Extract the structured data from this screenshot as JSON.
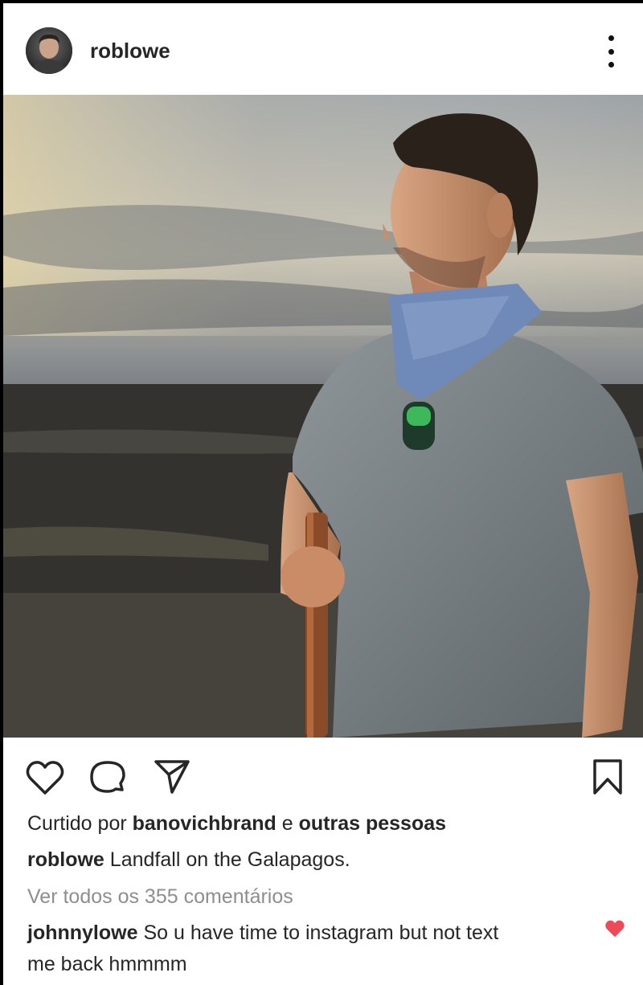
{
  "post": {
    "username": "roblowe",
    "image_alt": "Man in grey t-shirt and blue bandana holding a walking stick, looking out over a landscape at dusk"
  },
  "likes": {
    "prefix": "Curtido por",
    "user": "banovichbrand",
    "conjunction": "e",
    "others": "outras pessoas"
  },
  "caption": {
    "username": "roblowe",
    "text": "Landfall on the Galapagos."
  },
  "view_comments": "Ver todos os 355 comentários",
  "comment": {
    "username": "johnnylowe",
    "text_line1": "So u have time to instagram but not text",
    "text_line2": "me back hmmmm",
    "liked_color": "#ed4956"
  },
  "icons": {
    "more": "more-vertical-icon",
    "like": "heart-icon",
    "comment": "comment-icon",
    "share": "paper-plane-icon",
    "save": "bookmark-icon"
  }
}
